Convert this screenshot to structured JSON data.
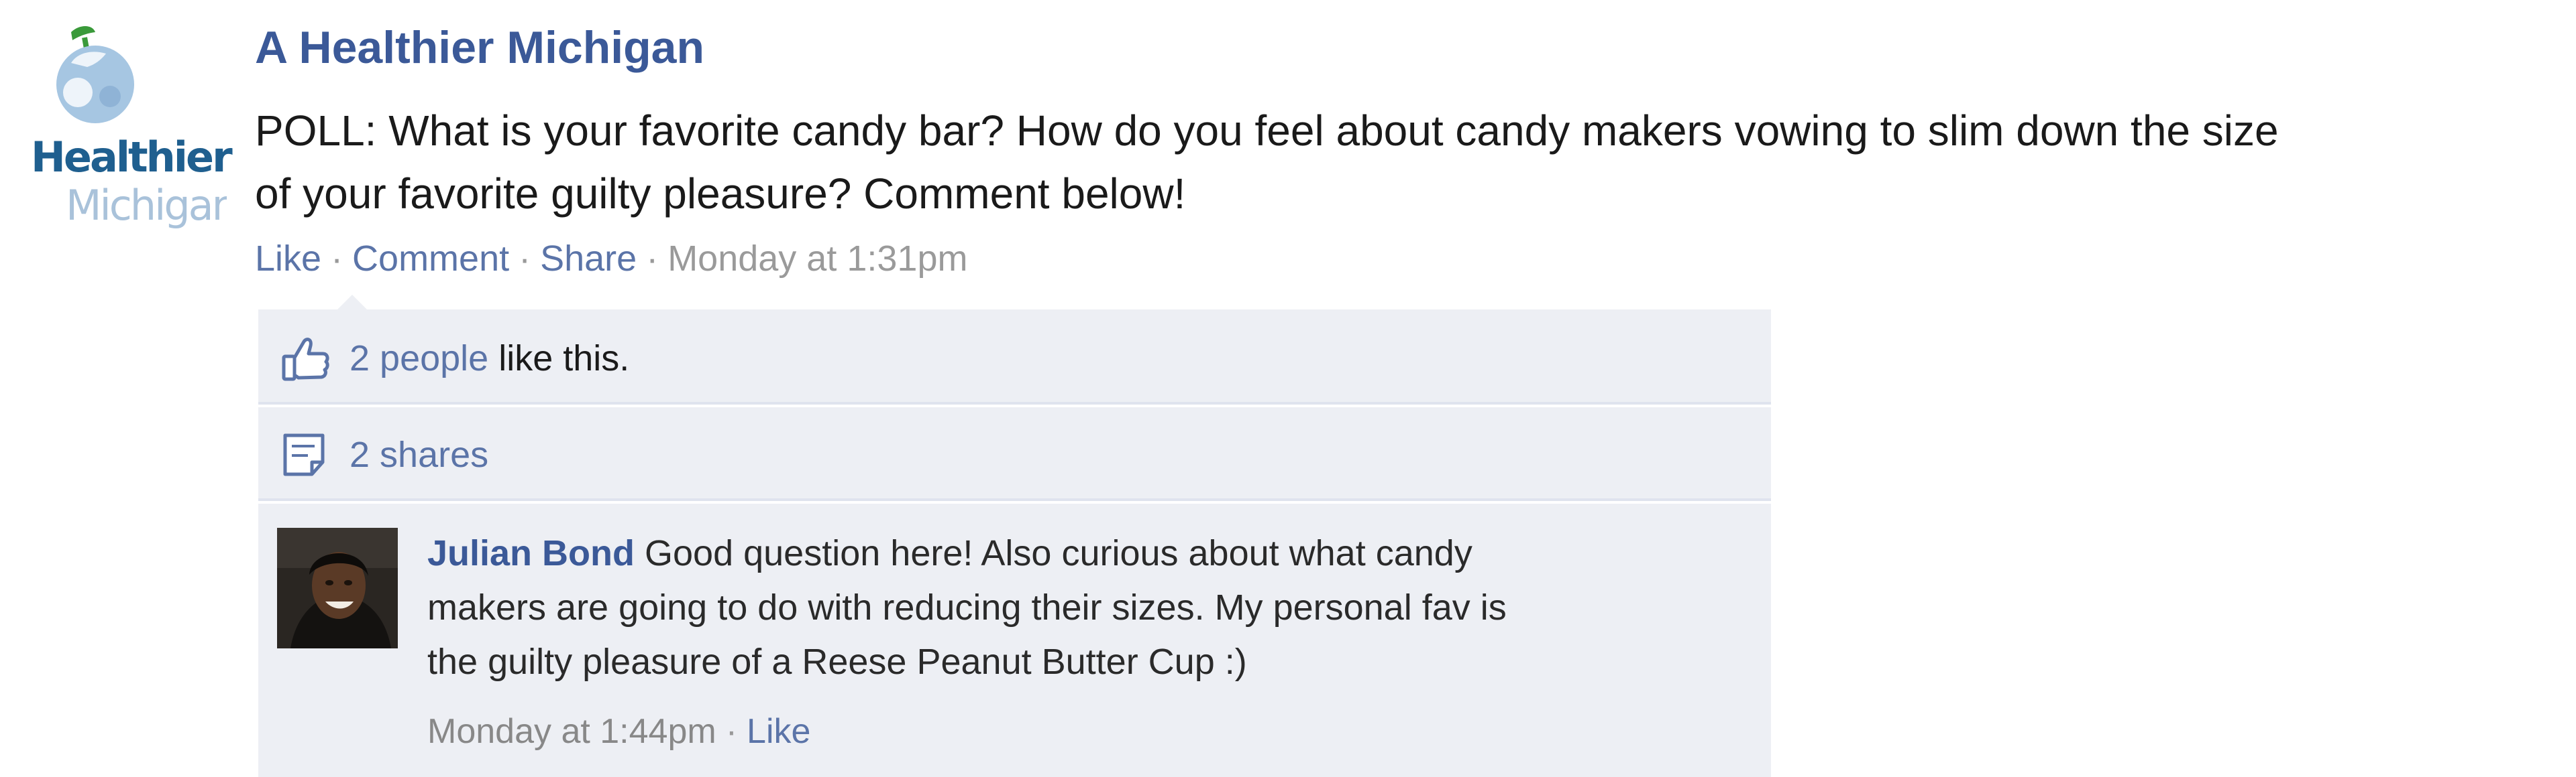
{
  "page": {
    "logo_line1": "Healthier",
    "logo_line2": "Michigan",
    "name": "A Healthier Michigan"
  },
  "post": {
    "message_line1": "POLL: What is your favorite candy bar? How do you feel about candy makers vowing to slim down the size",
    "message_line2": "of your favorite guilty pleasure? Comment below!",
    "actions": {
      "like": "Like",
      "comment": "Comment",
      "share": "Share",
      "separator": "·",
      "timestamp": "Monday at 1:31pm"
    }
  },
  "ufi": {
    "likes_link": "2 people",
    "likes_suffix": "like this.",
    "shares": "2 shares",
    "comment": {
      "author": "Julian Bond",
      "text_line1": "Good question here! Also curious about what candy",
      "text_line2": "makers are going to do with reducing their sizes. My personal fav is",
      "text_line3": "the guilty pleasure of a Reese Peanut Butter Cup :)",
      "timestamp": "Monday at 1:44pm",
      "separator": "·",
      "like": "Like"
    }
  },
  "icons": {
    "logo": "apple-logo-icon",
    "likes": "thumbs-up-icon",
    "shares": "share-note-icon"
  },
  "colors": {
    "link": "#3b5998",
    "ufi_background": "#edeff4",
    "muted": "#999999",
    "logo_dark": "#1f5f8f",
    "logo_light": "#a9c2da"
  }
}
